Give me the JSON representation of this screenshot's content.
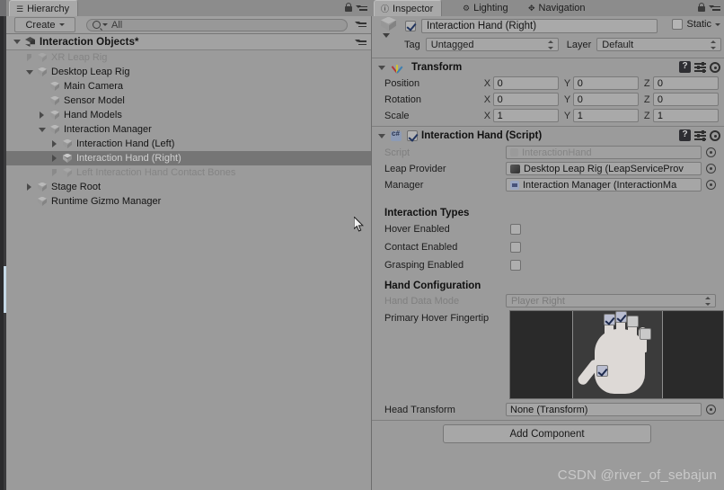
{
  "hierarchy": {
    "tab_label": "Hierarchy",
    "tab_icon": "hierarchy-icon",
    "create_label": "Create",
    "search_placeholder": "All",
    "search_value": "All",
    "scene_name": "Interaction Objects*",
    "items": [
      {
        "label": "XR Leap Rig",
        "indent": 1,
        "arrow": "closed",
        "dim": true,
        "selected": false
      },
      {
        "label": "Desktop Leap Rig",
        "indent": 1,
        "arrow": "open",
        "dim": false,
        "selected": false
      },
      {
        "label": "Main Camera",
        "indent": 2,
        "arrow": "none",
        "dim": false,
        "selected": false
      },
      {
        "label": "Sensor Model",
        "indent": 2,
        "arrow": "none",
        "dim": false,
        "selected": false
      },
      {
        "label": "Hand Models",
        "indent": 2,
        "arrow": "closed",
        "dim": false,
        "selected": false
      },
      {
        "label": "Interaction Manager",
        "indent": 2,
        "arrow": "open",
        "dim": false,
        "selected": false
      },
      {
        "label": "Interaction Hand (Left)",
        "indent": 3,
        "arrow": "closed",
        "dim": false,
        "selected": false
      },
      {
        "label": "Interaction Hand (Right)",
        "indent": 3,
        "arrow": "closed",
        "dim": false,
        "selected": true
      },
      {
        "label": "Left Interaction Hand Contact Bones",
        "indent": 3,
        "arrow": "closed",
        "dim": true,
        "selected": false
      },
      {
        "label": "Stage Root",
        "indent": 1,
        "arrow": "closed",
        "dim": false,
        "selected": false
      },
      {
        "label": "Runtime Gizmo Manager",
        "indent": 1,
        "arrow": "none",
        "dim": false,
        "selected": false
      }
    ]
  },
  "inspector": {
    "tabs": [
      {
        "label": "Inspector",
        "icon": "info-icon",
        "active": true
      },
      {
        "label": "Lighting",
        "icon": "lighting-icon",
        "active": false
      },
      {
        "label": "Navigation",
        "icon": "navigation-icon",
        "active": false
      }
    ],
    "object": {
      "enabled": true,
      "name": "Interaction Hand (Right)",
      "static_label": "Static",
      "static_checked": false,
      "tag_label": "Tag",
      "tag_value": "Untagged",
      "layer_label": "Layer",
      "layer_value": "Default"
    },
    "transform": {
      "title": "Transform",
      "rows": [
        {
          "name": "Position",
          "x": "0",
          "y": "0",
          "z": "0"
        },
        {
          "name": "Rotation",
          "x": "0",
          "y": "0",
          "z": "0"
        },
        {
          "name": "Scale",
          "x": "1",
          "y": "1",
          "z": "1"
        }
      ],
      "axis_labels": [
        "X",
        "Y",
        "Z"
      ]
    },
    "script_component": {
      "title": "Interaction Hand (Script)",
      "enabled": true,
      "fields": [
        {
          "name": "Script",
          "value": "InteractionHand",
          "dim": true,
          "icon": "script-icon"
        },
        {
          "name": "Leap Provider",
          "value": "Desktop Leap Rig (LeapServiceProv",
          "dim": false,
          "icon": "leap-icon"
        },
        {
          "name": "Manager",
          "value": "Interaction Manager (InteractionMa",
          "dim": false,
          "icon": "manager-icon"
        }
      ]
    },
    "interaction_types": {
      "header": "Interaction Types",
      "rows": [
        {
          "name": "Hover Enabled",
          "checked": false
        },
        {
          "name": "Contact Enabled",
          "checked": false
        },
        {
          "name": "Grasping Enabled",
          "checked": false
        }
      ]
    },
    "hand_configuration": {
      "header": "Hand Configuration",
      "hand_data_mode_label": "Hand Data Mode",
      "hand_data_mode_value": "Player Right",
      "primary_hover_label": "Primary Hover Fingertip",
      "fingertips": [
        {
          "name": "thumb",
          "checked": true
        },
        {
          "name": "index",
          "checked": true
        },
        {
          "name": "middle",
          "checked": true
        },
        {
          "name": "ring",
          "checked": false
        },
        {
          "name": "pinky",
          "checked": false
        }
      ]
    },
    "head_transform": {
      "name": "Head Transform",
      "value": "None (Transform)"
    },
    "add_component_label": "Add Component"
  },
  "watermark": "CSDN @river_of_sebajun",
  "colors": {
    "background": "#9b9b9b",
    "panel_header": "#8c8c8c",
    "selection": "#757575",
    "field": "#a9a9a9",
    "checkmark": "#21345e",
    "accent_blue": "#c5d8e6"
  }
}
